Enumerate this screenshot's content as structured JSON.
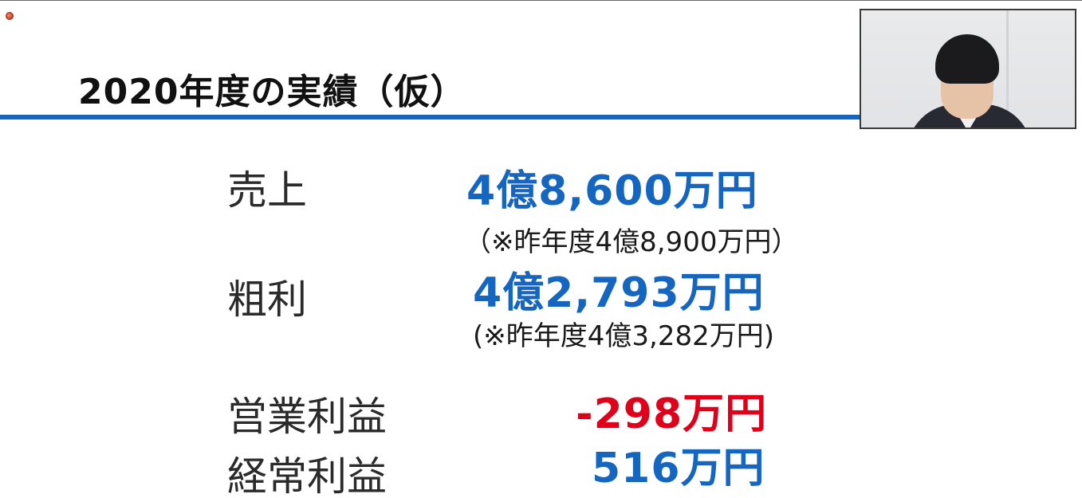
{
  "slide": {
    "title": "2020年度の実績（仮）"
  },
  "colors": {
    "accent_blue": "#1566c0",
    "negative_red": "#e0001a",
    "text": "#2a2a2a"
  },
  "metrics": {
    "sales": {
      "label": "売上",
      "value": "4億8,600万円",
      "note": "（※昨年度4億8,900万円）"
    },
    "gross_profit": {
      "label": "粗利",
      "value": "4億2,793万円",
      "note": "(※昨年度4億3,282万円)"
    },
    "operating_profit": {
      "label": "営業利益",
      "value": "-298万円"
    },
    "ordinary_profit": {
      "label": "経常利益",
      "value": "516万円"
    }
  },
  "overlay": {
    "recording_icon": "record-dot-icon",
    "camera_feed": "presenter-video"
  }
}
